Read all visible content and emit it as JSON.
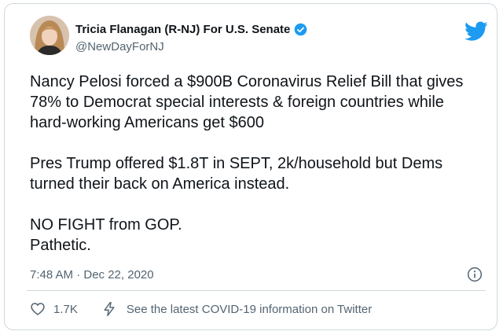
{
  "tweet": {
    "display_name": "Tricia Flanagan (R-NJ) For U.S. Senate",
    "handle": "@NewDayForNJ",
    "paragraphs": [
      [
        "Nancy Pelosi forced a $900B Coronavirus Relief Bill that gives",
        "78% to Democrat special interests & foreign countries while",
        "hard-working Americans get $600"
      ],
      [
        "Pres Trump offered $1.8T in SEPT, 2k/household but Dems",
        "turned their back on America instead."
      ],
      [
        "NO FIGHT from GOP.",
        "Pathetic."
      ]
    ],
    "timestamp": "7:48 AM · Dec 22, 2020",
    "like_count": "1.7K",
    "covid_link": "See the latest COVID-19 information on Twitter"
  },
  "icons": {
    "verified": "verified-badge-icon",
    "brand": "twitter-bird-icon",
    "info": "info-icon",
    "like": "heart-icon",
    "covid": "lightning-icon"
  },
  "colors": {
    "brand": "#1d9bf0",
    "text": "#0f1419",
    "secondary": "#536471",
    "border": "#cfd9de"
  }
}
